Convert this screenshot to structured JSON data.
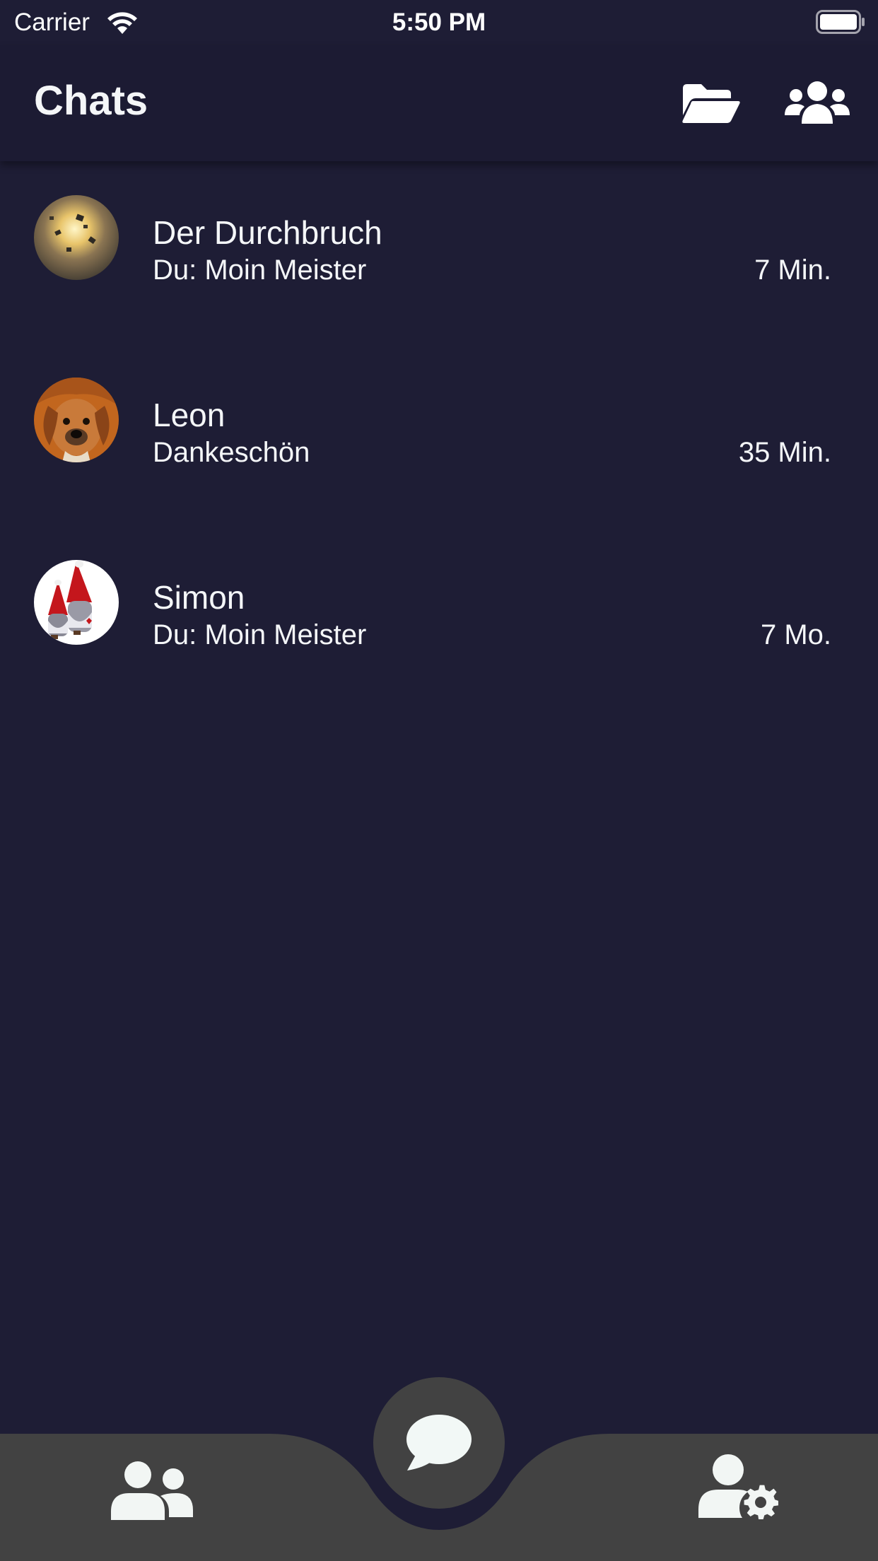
{
  "status_bar": {
    "carrier": "Carrier",
    "time": "5:50 PM",
    "wifi_icon": "wifi-icon",
    "battery_icon": "battery-icon"
  },
  "header": {
    "title": "Chats",
    "folder_icon": "folder-open-icon",
    "groups_icon": "users-icon"
  },
  "chats": [
    {
      "name": "Der Durchbruch",
      "preview": "Du: Moin Meister",
      "time": "7 Min.",
      "avatar": "explosion-image"
    },
    {
      "name": "Leon",
      "preview": "Dankeschön",
      "time": "35 Min.",
      "avatar": "dog-image"
    },
    {
      "name": "Simon",
      "preview": "Du: Moin Meister",
      "time": "7 Mo.",
      "avatar": "gnomes-image"
    }
  ],
  "bottom_nav": {
    "contacts_icon": "contacts-icon",
    "chats_icon": "chat-bubble-icon",
    "settings_icon": "user-settings-icon"
  },
  "colors": {
    "background": "#1e1d35",
    "header": "#1c1b33",
    "nav_bar": "#424242",
    "text": "#f4f6f8"
  }
}
